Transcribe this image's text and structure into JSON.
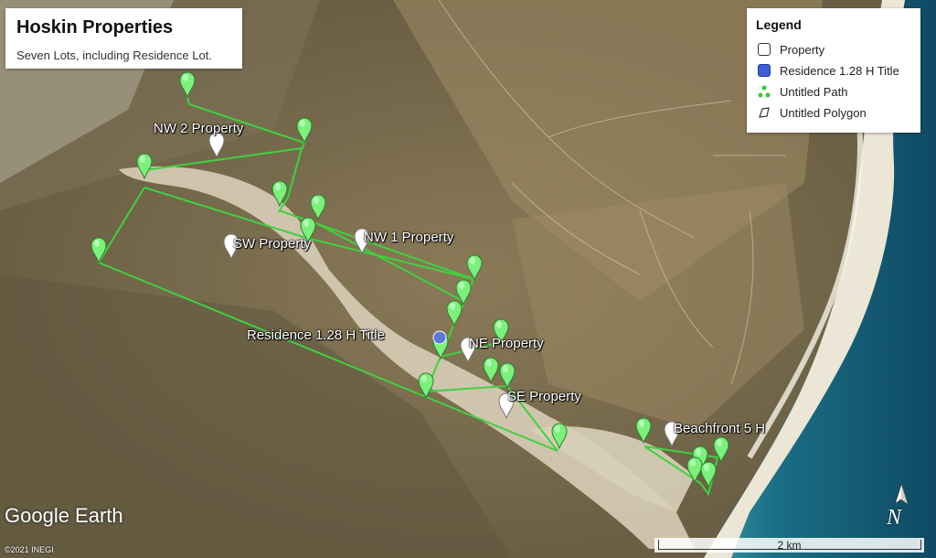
{
  "title_box": {
    "title": "Hoskin Properties",
    "subtitle": "Seven Lots, including Residence Lot."
  },
  "legend": {
    "heading": "Legend",
    "items": [
      {
        "label": "Property",
        "icon": "white-square-icon"
      },
      {
        "label": "Residence 1.28 H Title",
        "icon": "blue-square-icon",
        "color": "#3e5ed6"
      },
      {
        "label": "Untitled Path",
        "icon": "green-path-icon",
        "color": "#33cc33"
      },
      {
        "label": "Untitled Polygon",
        "icon": "polygon-icon"
      }
    ]
  },
  "places": {
    "nw2": "NW 2 Property",
    "nw1": "NW 1 Property",
    "sw": "SW Property",
    "residence": "Residence 1.28 H Title",
    "ne": "NE Property",
    "se": "SE Property",
    "beachfront": "Beachfront 5 H"
  },
  "branding": {
    "logo": "Google Earth",
    "copyright": "©2021 INEGI"
  },
  "scale": {
    "label": "2 km"
  },
  "compass": {
    "label": "N"
  },
  "colors": {
    "terrain": "#7a6c4d",
    "sand": "#d7cdb6",
    "ocean": "#14607a",
    "path": "#3ed23e",
    "pin": "#7cf07c"
  }
}
